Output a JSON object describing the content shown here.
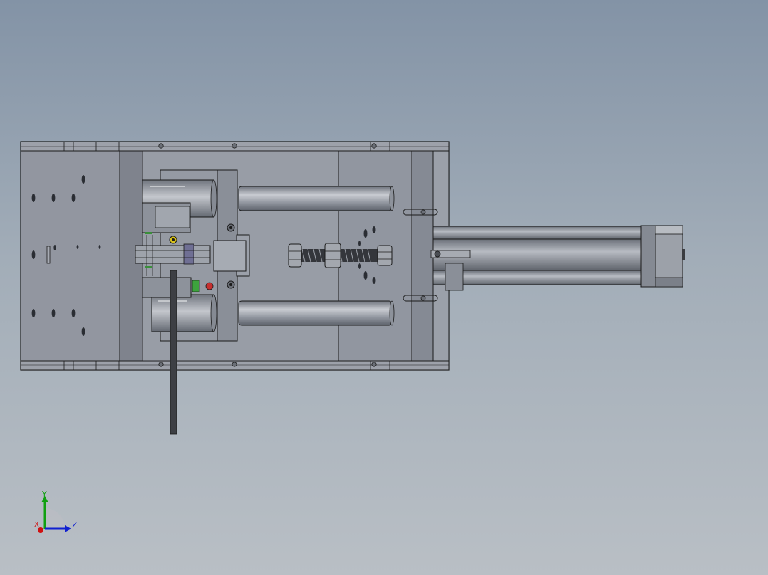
{
  "viewport": {
    "background_top": "#8393a6",
    "background_bottom": "#b9bfc5"
  },
  "model": {
    "frame_color": "#8e929c",
    "plate_color": "#9499a3",
    "edge_color": "#1a1a1a",
    "rod_color": "#8a8f98",
    "spring_color": "#3a3a3a"
  },
  "triad": {
    "x_label": "X",
    "y_label": "Y",
    "z_label": "Z",
    "x_color": "#d01010",
    "y_color": "#10a010",
    "z_color": "#1020d0"
  }
}
